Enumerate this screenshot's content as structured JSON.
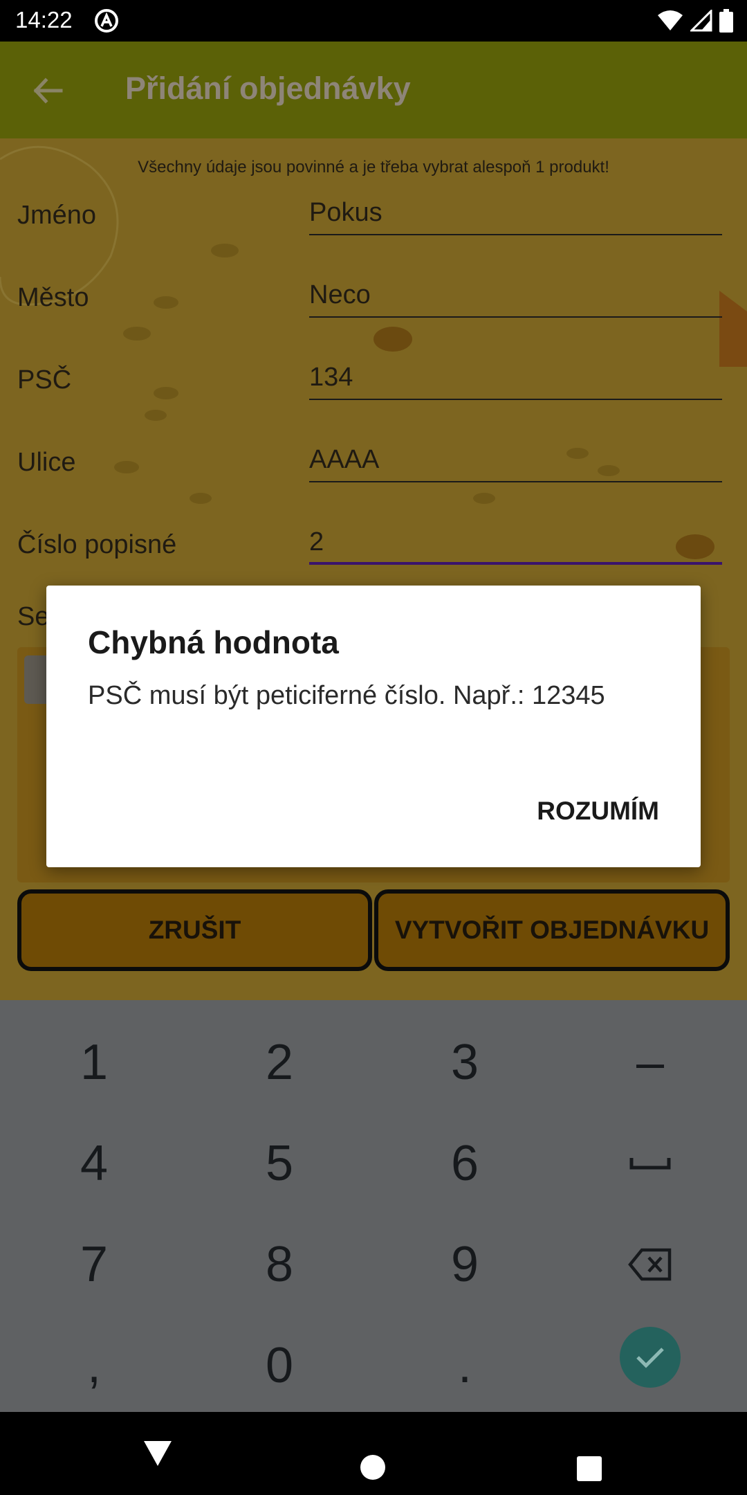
{
  "status_bar": {
    "time": "14:22"
  },
  "app_bar": {
    "title": "Přidání objednávky"
  },
  "form": {
    "notice": "Všechny údaje jsou povinné a je třeba vybrat alespoň 1 produkt!",
    "fields": [
      {
        "label": "Jméno",
        "value": "Pokus"
      },
      {
        "label": "Město",
        "value": "Neco"
      },
      {
        "label": "PSČ",
        "value": "134"
      },
      {
        "label": "Ulice",
        "value": "AAAA"
      },
      {
        "label": "Číslo popisné",
        "value": "2"
      }
    ],
    "partial_label": "Se"
  },
  "buttons": {
    "cancel": "ZRUŠIT",
    "create": "VYTVOŘIT OBJEDNÁVKU"
  },
  "dialog": {
    "title": "Chybná hodnota",
    "message": "PSČ musí být peticiferné číslo. Např.: 12345",
    "confirm": "ROZUMÍM"
  },
  "keyboard": {
    "keys": [
      "1",
      "2",
      "3",
      "–",
      "4",
      "5",
      "6",
      "␣",
      "7",
      "8",
      "9",
      "backspace",
      ",",
      "0",
      ".",
      "done"
    ],
    "icons": {
      "space": "space-icon",
      "backspace": "backspace-icon",
      "done": "check-icon"
    }
  },
  "colors": {
    "app_bar": "#5b6107",
    "background_dimmed": "#7d6520",
    "button_fill": "#6f4b05",
    "focus_underline": "#3a136d",
    "done_key": "#24625d"
  }
}
